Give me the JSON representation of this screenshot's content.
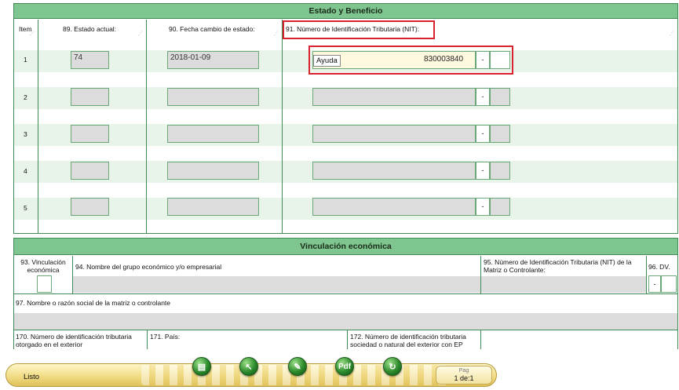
{
  "section1": {
    "title": "Estado y Beneficio",
    "col_item": "Item",
    "col_estado": "89. Estado actual:",
    "col_fecha": "90. Fecha cambio de estado:",
    "col_nit": "91. Número de Identificación Tributaria (NIT):",
    "rows": [
      {
        "item": "1",
        "estado": "74",
        "fecha": "2018-01-09",
        "nit": "830003840",
        "dv": "-"
      },
      {
        "item": "2",
        "estado": "",
        "fecha": "",
        "nit": "",
        "dv": "-"
      },
      {
        "item": "3",
        "estado": "",
        "fecha": "",
        "nit": "",
        "dv": "-"
      },
      {
        "item": "4",
        "estado": "",
        "fecha": "",
        "nit": "",
        "dv": "-"
      },
      {
        "item": "5",
        "estado": "",
        "fecha": "",
        "nit": "",
        "dv": "-"
      }
    ],
    "ayuda_label": "Ayuda"
  },
  "section2": {
    "title": "Vinculación económica",
    "f93": "93. Vinculación económica",
    "f94": "94. Nombre del grupo económico y/o empresarial",
    "f95": "95. Número de Identificación Tributaria (NIT) de la Matriz o Controlante:",
    "f96": "96. DV.",
    "f96_dash": "-",
    "f97": "97. Nombre o razón social de la matriz o controlante",
    "f170": "170. Número de identificación tributaria otorgado en el exterior",
    "f171": "171. País:",
    "f172": "172. Número de identificación tributaria sociedad o natural del exterior con EP"
  },
  "statusbar": {
    "status": "Listo",
    "pag_label": "Pag",
    "pag_value": "1 de:1"
  }
}
